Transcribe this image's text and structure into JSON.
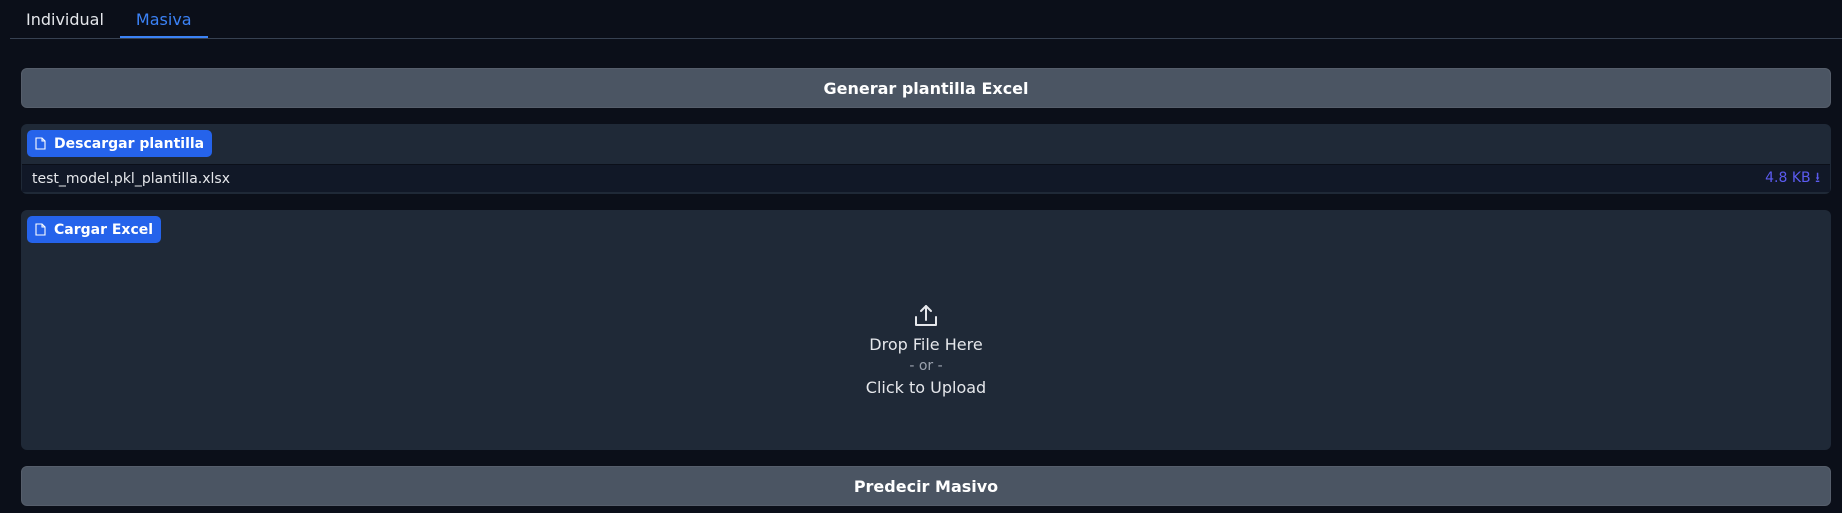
{
  "tabs": [
    {
      "label": "Individual",
      "active": false
    },
    {
      "label": "Masiva",
      "active": true
    }
  ],
  "generate_button": {
    "label": "Generar plantilla Excel"
  },
  "download_panel": {
    "badge_label": "Descargar plantilla",
    "file_name": "test_model.pkl_plantilla.xlsx",
    "file_size": "4.8 KB ⭳"
  },
  "upload_panel": {
    "badge_label": "Cargar Excel",
    "drop_text": "Drop File Here",
    "or_text": "- or -",
    "click_text": "Click to Upload"
  },
  "predict_button": {
    "label": "Predecir Masivo"
  },
  "colors": {
    "background": "#0b0f19",
    "panel": "#1f2937",
    "button": "#4b5563",
    "accent": "#2563eb",
    "active_tab": "#3b82f6"
  }
}
